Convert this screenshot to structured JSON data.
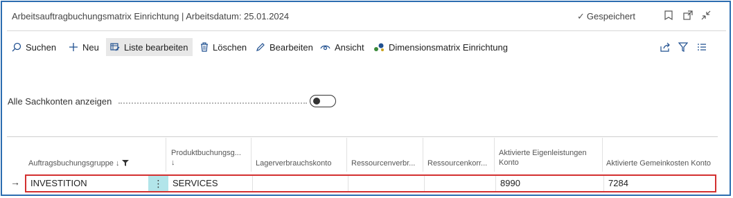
{
  "header": {
    "title": "Arbeitsauftragbuchungsmatrix Einrichtung | Arbeitsdatum: 25.01.2024",
    "saved_label": "Gespeichert",
    "icons": [
      "bookmark-icon",
      "open-in-new-window-icon",
      "collapse-icon"
    ]
  },
  "actions": {
    "search": "Suchen",
    "new": "Neu",
    "edit_list": "Liste bearbeiten",
    "delete": "Löschen",
    "edit": "Bearbeiten",
    "view": "Ansicht",
    "dimensions": "Dimensionsmatrix Einrichtung"
  },
  "toggle": {
    "label": "Alle Sachkonten anzeigen",
    "state": "off"
  },
  "table": {
    "columns": [
      "Auftragsbuchungsgruppe ↓",
      "Produktbuchungsg...",
      "↓",
      "Lagerverbrauchskonto",
      "Ressourcenverbr...",
      "Ressourcenkorr...",
      "Aktivierte Eigenleistungen",
      "Konto",
      "Aktivierte Gemeinkosten Konto"
    ],
    "rows": [
      {
        "auftragsbuchungsgruppe": "INVESTITION",
        "produktbuchungsgruppe": "SERVICES",
        "lagerverbrauchskonto": "",
        "ressourcenverbrauch": "",
        "ressourcenkorrektur": "",
        "aktivierte_eigenleistungen_konto": "8990",
        "aktivierte_gemeinkosten_konto": "7284"
      }
    ]
  },
  "colors": {
    "accent": "#1f4f8f",
    "frame": "#2b6cb0",
    "selection_border": "#d32f2f",
    "row_menu": "#b2e5ea"
  }
}
